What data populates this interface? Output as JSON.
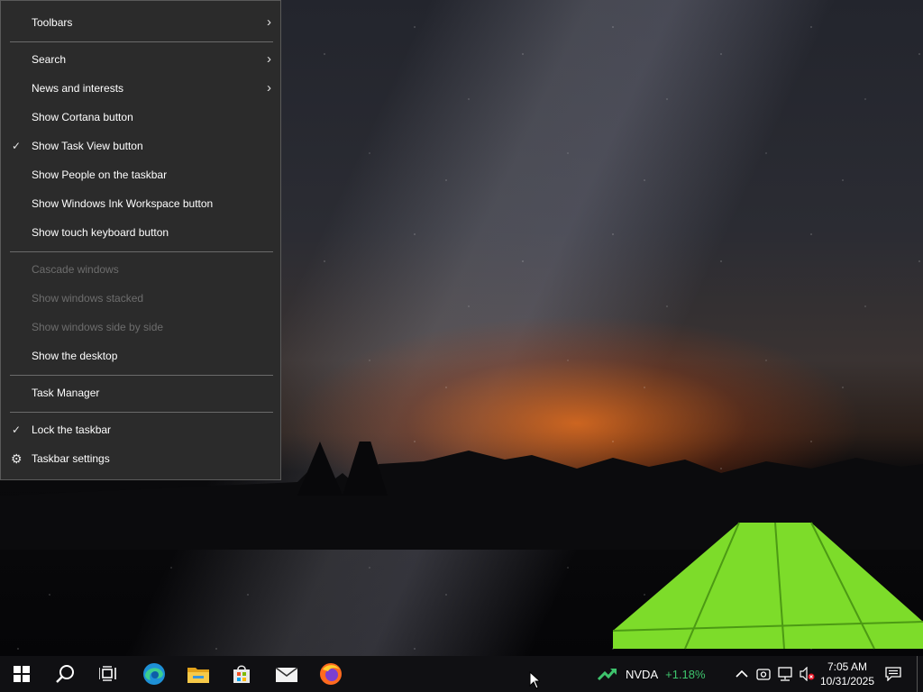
{
  "context_menu": {
    "toolbars": "Toolbars",
    "search": "Search",
    "news": "News and interests",
    "cortana": "Show Cortana button",
    "task_view": "Show Task View button",
    "people": "Show People on the taskbar",
    "ink": "Show Windows Ink Workspace button",
    "touch_keyboard": "Show touch keyboard button",
    "cascade": "Cascade windows",
    "stacked": "Show windows stacked",
    "side_by_side": "Show windows side by side",
    "desktop": "Show the desktop",
    "task_manager": "Task Manager",
    "lock": "Lock the taskbar",
    "settings": "Taskbar settings",
    "checked_items": [
      "Show Task View button",
      "Lock the taskbar"
    ],
    "disabled_items": [
      "Cascade windows",
      "Show windows stacked",
      "Show windows side by side"
    ]
  },
  "taskbar": {
    "pinned_icons": [
      "start-icon",
      "search-icon",
      "task-view-icon",
      "edge-icon",
      "file-explorer-icon",
      "store-icon",
      "mail-icon",
      "firefox-icon"
    ],
    "stock": {
      "symbol": "NVDA",
      "change": "+1.18%",
      "change_color": "#3ec46d"
    },
    "tray_icons": [
      "chevron-up-icon",
      "meet-now-icon",
      "network-icon",
      "volume-muted-icon"
    ],
    "time": "7:05 AM",
    "date": "10/31/2025"
  }
}
